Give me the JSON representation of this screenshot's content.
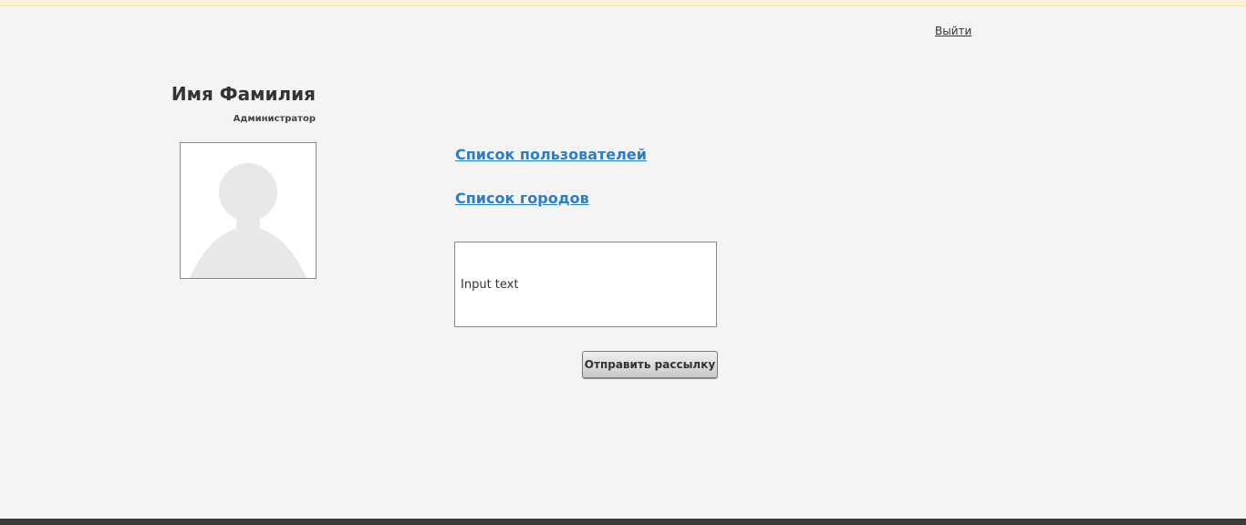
{
  "header": {
    "logout_label": "Выйти"
  },
  "profile": {
    "name": "Имя Фамилия",
    "role": "Администратор",
    "avatar_icon": "user-silhouette-icon"
  },
  "nav": {
    "users_link": "Список пользователей",
    "cities_link": "Список городов"
  },
  "mailing": {
    "input_value": "Input text",
    "send_button_label": "Отправить рассылку"
  },
  "colors": {
    "link": "#2a7ec8",
    "background": "#f4f4f4",
    "bottom_bar": "#3a3a3c"
  }
}
